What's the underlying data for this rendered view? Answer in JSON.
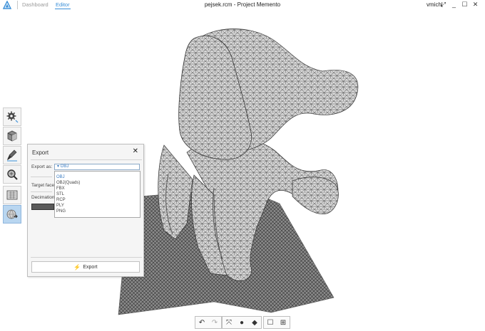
{
  "titlebar": {
    "tabs": [
      {
        "label": "Dashboard"
      },
      {
        "label": "Editor"
      }
    ],
    "window_title": "pejsek.rcm - Project Memento",
    "user": "vmichl",
    "controls": {
      "popout": "⤢",
      "minimize": "_",
      "maximize": "☐",
      "close": "✕"
    }
  },
  "toolbar": {
    "buttons": [
      {
        "icon": "gear-sparkle-icon",
        "active": false
      },
      {
        "icon": "cube-icon",
        "active": false
      },
      {
        "icon": "brush-icon",
        "active": false
      },
      {
        "icon": "magnify-icon",
        "active": false
      },
      {
        "icon": "measure-icon",
        "active": false
      },
      {
        "icon": "export-sphere-icon",
        "active": true
      }
    ]
  },
  "export_panel": {
    "title": "Export",
    "close": "✕",
    "export_as_label": "Export as:",
    "selected_format": "▾ OBJ",
    "target_faces_label": "Target face",
    "decimation_label": "Decimation",
    "options": [
      "OBJ",
      "OBJ(Quads)",
      "FBX",
      "STL",
      "RCP",
      "PLY",
      "PNG"
    ],
    "export_button": "Export"
  },
  "bottom_toolbar": {
    "undo": "↶",
    "redo": "↷",
    "fit": "⤧",
    "pin": "●",
    "cube": "◆",
    "frame": "☐",
    "frame_plus": "⊞"
  },
  "colors": {
    "accent": "#3a8fd8",
    "active_tool": "#b9d6f0",
    "mesh_fill": "#d9d9d9",
    "mesh_wire": "#4a4a4a"
  }
}
